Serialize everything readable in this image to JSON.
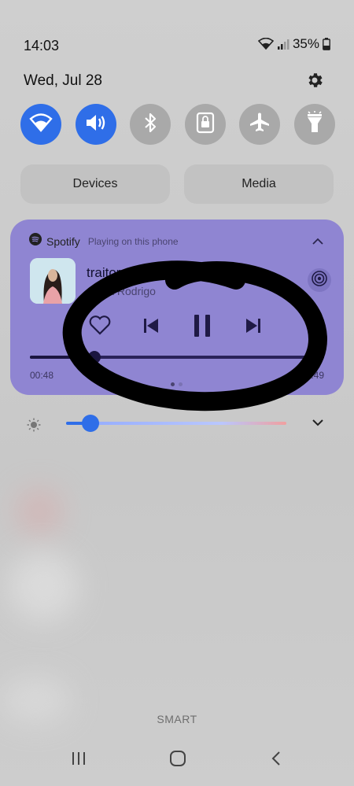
{
  "status_bar": {
    "time": "14:03",
    "battery_text": "35%"
  },
  "header": {
    "date": "Wed, Jul 28"
  },
  "quick_toggles": [
    {
      "name": "wifi",
      "icon": "wifi-icon",
      "state": "on"
    },
    {
      "name": "sound",
      "icon": "speaker-icon",
      "state": "on"
    },
    {
      "name": "bluetooth",
      "icon": "bluetooth-icon",
      "state": "off"
    },
    {
      "name": "rotation-lock",
      "icon": "lock-icon",
      "state": "off"
    },
    {
      "name": "airplane-mode",
      "icon": "airplane-icon",
      "state": "off"
    },
    {
      "name": "flashlight",
      "icon": "flashlight-icon",
      "state": "off"
    }
  ],
  "pills": {
    "devices": "Devices",
    "media": "Media"
  },
  "media_player": {
    "app": "Spotify",
    "subtitle": "Playing on this phone",
    "track": "traitor",
    "artist": "Olivia Rodrigo",
    "elapsed": "00:48",
    "duration": "3:49",
    "progress": 0.22
  },
  "brightness": {
    "level": 0.11
  },
  "carrier": "SMART",
  "colors": {
    "accent": "#2f6ee8",
    "media_card": "#8f85d2",
    "toggle_off": "#a9a9a9"
  }
}
